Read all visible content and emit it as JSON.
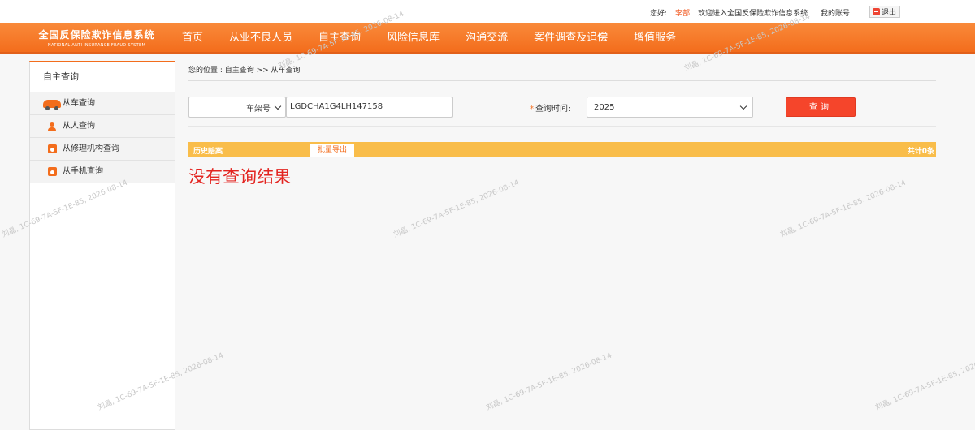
{
  "topbar": {
    "greeting": "您好:",
    "user": "李部",
    "welcome": "欢迎进入全国反保险欺诈信息系统",
    "my_account": "| 我的账号",
    "logout": "退出"
  },
  "logo": {
    "cn": "全国反保险欺诈信息系统",
    "en": "NATIONAL ANTI INSURANCE FRAUD SYSTEM"
  },
  "nav": {
    "items": [
      {
        "label": "首页"
      },
      {
        "label": "从业不良人员"
      },
      {
        "label": "自主查询"
      },
      {
        "label": "风险信息库"
      },
      {
        "label": "沟通交流"
      },
      {
        "label": "案件调查及追偿"
      },
      {
        "label": "增值服务"
      }
    ]
  },
  "sidebar": {
    "title": "自主查询",
    "items": [
      {
        "label": "从车查询",
        "icon": "car-icon"
      },
      {
        "label": "从人查询",
        "icon": "person-icon"
      },
      {
        "label": "从修理机构查询",
        "icon": "repair-shop-icon"
      },
      {
        "label": "从手机查询",
        "icon": "phone-query-icon"
      }
    ]
  },
  "main": {
    "breadcrumb": "您的位置 : 自主查询 >> 从车查询",
    "query": {
      "type_selected": "车架号",
      "vin_value": "LGDCHA1G4LH147158",
      "time_star": "*",
      "time_label": "查询时间:",
      "year_selected": "2025",
      "query_button": "查询"
    },
    "result": {
      "header": "历史赔案",
      "export_button": "批量导出",
      "total": "共计0条",
      "empty_text": "没有查询结果"
    }
  },
  "watermark": "刘晶, 1C-69-7A-5F-1E-85, 2026-08-14",
  "colors": {
    "nav_orange": "#f36d1c",
    "result_bar": "#f9bd4a",
    "query_button": "#f5452b",
    "no_result_red": "#e32521"
  }
}
